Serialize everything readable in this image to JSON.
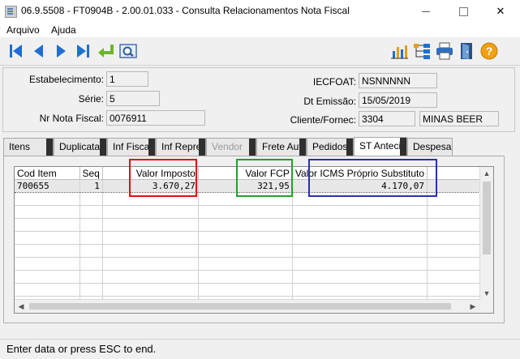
{
  "window": {
    "title": "06.9.5508 - FT0904B - 2.00.01.033 - Consulta Relacionamentos Nota Fiscal",
    "minimize_glyph": "—",
    "close_glyph": "✕"
  },
  "menu": {
    "items": [
      "Arquivo",
      "Ajuda"
    ]
  },
  "toolbar": {
    "buttons": [
      "first-icon",
      "previous-icon",
      "next-icon",
      "last-icon",
      "goto-icon",
      "search-icon",
      "chart-icon",
      "tree-icon",
      "print-icon",
      "exit-door-icon",
      "help-icon"
    ],
    "help_glyph": "?"
  },
  "header": {
    "estabelecimento_label": "Estabelecimento:",
    "estabelecimento_value": "1",
    "serie_label": "Série:",
    "serie_value": "5",
    "nr_nota_label": "Nr Nota Fiscal:",
    "nr_nota_value": "0076911",
    "iecfoat_label": "IECFOAT:",
    "iecfoat_value": "NSNNNNN",
    "dt_emissao_label": "Dt Emissão:",
    "dt_emissao_value": "15/05/2019",
    "cliente_label": "Cliente/Fornec:",
    "cliente_code": "3304",
    "cliente_name": "MINAS BEER"
  },
  "tabs": [
    {
      "label": "Itens"
    },
    {
      "label": "Duplicata"
    },
    {
      "label": "Inf Fiscais"
    },
    {
      "label": "Inf Repre"
    },
    {
      "label": "Vendor"
    },
    {
      "label": "Frete Aut"
    },
    {
      "label": "Pedidos"
    },
    {
      "label": "ST Anteci"
    },
    {
      "label": "Despesas"
    }
  ],
  "grid": {
    "columns": [
      "Cod Item",
      "Seq",
      "Valor Imposto",
      "Valor FCP",
      "Valor ICMS Próprio Substituto"
    ],
    "rows": [
      {
        "cod_item": "700655",
        "seq": "1",
        "valor_imposto": "3.670,27",
        "valor_fcp": "321,95",
        "valor_icms": "4.170,07"
      }
    ],
    "scroll_up": "▲",
    "scroll_down": "▼",
    "scroll_left": "◀",
    "scroll_right": "▶"
  },
  "highlight_colors": {
    "red": "#e01010",
    "green": "#1fa22a",
    "blue": "#2b2fb0"
  },
  "status": {
    "text": "Enter data or press ESC to end."
  }
}
